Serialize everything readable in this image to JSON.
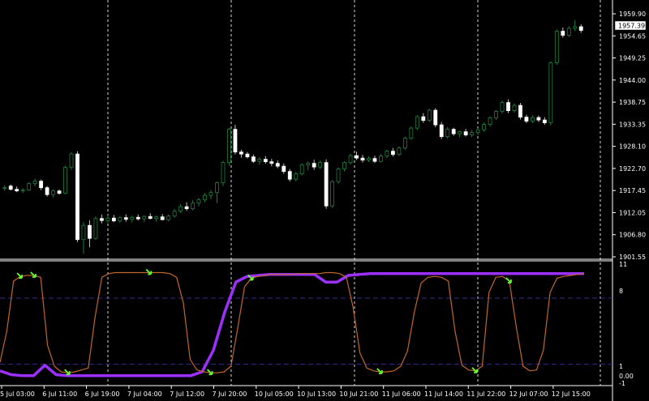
{
  "price_axis_labels": [
    "1959.90",
    "1954.65",
    "1949.25",
    "1944.00",
    "1938.75",
    "1933.35",
    "1928.10",
    "1922.70",
    "1917.45",
    "1912.05",
    "1906.80",
    "1901.55"
  ],
  "current_price": "1957.39",
  "indicator_axis_labels": [
    "11",
    "8",
    "1",
    "0.00",
    "-1"
  ],
  "time_labels": [
    "5 Jul 03:00",
    "6 Jul 11:00",
    "6 Jul 19:00",
    "7 Jul 04:00",
    "7 Jul 12:00",
    "7 Jul 20:00",
    "10 Jul 05:00",
    "10 Jul 13:00",
    "10 Jul 21:00",
    "11 Jul 06:00",
    "11 Jul 14:00",
    "11 Jul 22:00",
    "12 Jul 07:00",
    "12 Jul 15:00"
  ],
  "colors": {
    "background": "#000000",
    "candle_bull": "#000000",
    "candle_bull_border": "#1e7f3c",
    "candle_bear": "#ffffff",
    "grid": "#ffffff",
    "fast_line": "#c0672a",
    "slow_line": "#9b30ff",
    "level_line": "#3a2a8c",
    "arrow": "#66ff33"
  },
  "chart_data": [
    {
      "type": "candlestick",
      "title": "",
      "ylim": [
        1901.55,
        1961.5
      ],
      "candles": [
        [
          1918.6,
          1919.2,
          1917.8,
          1918.6
        ],
        [
          1919.0,
          1919.4,
          1917.9,
          1918.2
        ],
        [
          1918.2,
          1918.9,
          1917.5,
          1917.8
        ],
        [
          1917.8,
          1918.5,
          1917.3,
          1918.0
        ],
        [
          1918.0,
          1920.0,
          1917.8,
          1919.6
        ],
        [
          1919.6,
          1920.8,
          1919.0,
          1920.2
        ],
        [
          1920.2,
          1920.6,
          1918.0,
          1918.6
        ],
        [
          1918.6,
          1919.0,
          1916.4,
          1916.9
        ],
        [
          1916.9,
          1918.2,
          1916.2,
          1917.8
        ],
        [
          1917.8,
          1918.1,
          1916.9,
          1917.2
        ],
        [
          1917.2,
          1924.0,
          1917.0,
          1923.6
        ],
        [
          1923.6,
          1927.4,
          1923.0,
          1926.9
        ],
        [
          1926.9,
          1927.6,
          1905.2,
          1905.8
        ],
        [
          1905.8,
          1910.1,
          1902.3,
          1909.3
        ],
        [
          1909.3,
          1910.6,
          1903.9,
          1906.1
        ],
        [
          1906.1,
          1911.5,
          1905.8,
          1911.0
        ],
        [
          1911.0,
          1912.0,
          1909.8,
          1910.5
        ],
        [
          1910.5,
          1911.8,
          1909.9,
          1911.1
        ],
        [
          1911.1,
          1911.9,
          1910.1,
          1910.4
        ],
        [
          1910.4,
          1911.6,
          1909.9,
          1911.2
        ],
        [
          1911.2,
          1912.0,
          1910.2,
          1910.8
        ],
        [
          1910.8,
          1911.7,
          1910.0,
          1911.3
        ],
        [
          1911.3,
          1912.0,
          1910.5,
          1910.9
        ],
        [
          1910.9,
          1911.8,
          1910.1,
          1911.5
        ],
        [
          1911.5,
          1912.3,
          1910.8,
          1911.0
        ],
        [
          1911.0,
          1911.7,
          1910.2,
          1911.4
        ],
        [
          1911.4,
          1912.1,
          1910.6,
          1910.7
        ],
        [
          1910.7,
          1912.0,
          1910.3,
          1911.6
        ],
        [
          1911.6,
          1913.4,
          1911.2,
          1912.8
        ],
        [
          1912.8,
          1914.6,
          1912.3,
          1913.9
        ],
        [
          1913.9,
          1915.0,
          1912.9,
          1913.4
        ],
        [
          1913.4,
          1915.5,
          1913.0,
          1914.8
        ],
        [
          1914.8,
          1916.1,
          1914.0,
          1915.6
        ],
        [
          1915.6,
          1917.3,
          1915.0,
          1916.7
        ],
        [
          1916.7,
          1918.0,
          1915.8,
          1917.4
        ],
        [
          1917.4,
          1920.1,
          1914.8,
          1919.8
        ],
        [
          1919.8,
          1925.2,
          1919.0,
          1924.8
        ],
        [
          1924.8,
          1933.4,
          1924.0,
          1933.0
        ],
        [
          1933.0,
          1934.1,
          1926.8,
          1927.4
        ],
        [
          1927.4,
          1928.0,
          1926.0,
          1926.9
        ],
        [
          1926.9,
          1927.4,
          1925.8,
          1926.2
        ],
        [
          1926.2,
          1926.8,
          1924.7,
          1925.1
        ],
        [
          1925.1,
          1926.1,
          1924.3,
          1925.6
        ],
        [
          1925.6,
          1926.4,
          1924.5,
          1925.0
        ],
        [
          1925.0,
          1925.7,
          1923.9,
          1924.6
        ],
        [
          1924.6,
          1925.3,
          1923.4,
          1923.9
        ],
        [
          1923.9,
          1924.6,
          1922.0,
          1922.6
        ],
        [
          1922.6,
          1923.2,
          1920.1,
          1920.7
        ],
        [
          1920.7,
          1922.5,
          1920.2,
          1922.0
        ],
        [
          1922.0,
          1924.6,
          1921.6,
          1924.2
        ],
        [
          1924.2,
          1925.1,
          1922.9,
          1924.6
        ],
        [
          1924.6,
          1925.5,
          1923.0,
          1923.7
        ],
        [
          1923.7,
          1925.3,
          1923.2,
          1924.8
        ],
        [
          1924.8,
          1925.6,
          1913.4,
          1914.1
        ],
        [
          1914.1,
          1920.5,
          1913.6,
          1920.1
        ],
        [
          1920.1,
          1923.6,
          1919.6,
          1923.2
        ],
        [
          1923.2,
          1925.1,
          1922.6,
          1924.8
        ],
        [
          1924.8,
          1927.0,
          1924.3,
          1926.5
        ],
        [
          1926.5,
          1927.5,
          1925.4,
          1925.9
        ],
        [
          1925.9,
          1926.7,
          1924.8,
          1925.4
        ],
        [
          1925.4,
          1926.3,
          1924.9,
          1925.8
        ],
        [
          1925.8,
          1926.5,
          1924.7,
          1925.1
        ],
        [
          1925.1,
          1926.9,
          1924.8,
          1926.4
        ],
        [
          1926.4,
          1928.0,
          1925.9,
          1927.6
        ],
        [
          1927.6,
          1928.4,
          1926.3,
          1926.8
        ],
        [
          1926.8,
          1928.8,
          1926.4,
          1928.4
        ],
        [
          1928.4,
          1931.2,
          1927.9,
          1930.8
        ],
        [
          1930.8,
          1933.7,
          1930.4,
          1933.3
        ],
        [
          1933.3,
          1936.5,
          1932.8,
          1936.1
        ],
        [
          1936.1,
          1937.0,
          1934.6,
          1935.2
        ],
        [
          1935.2,
          1938.1,
          1934.8,
          1937.7
        ],
        [
          1937.7,
          1938.2,
          1933.5,
          1934.1
        ],
        [
          1934.1,
          1934.8,
          1930.6,
          1931.2
        ],
        [
          1931.2,
          1933.6,
          1930.7,
          1933.0
        ],
        [
          1933.0,
          1933.4,
          1931.4,
          1931.9
        ],
        [
          1931.9,
          1932.7,
          1931.0,
          1932.4
        ],
        [
          1932.4,
          1933.1,
          1931.2,
          1931.6
        ],
        [
          1931.6,
          1932.8,
          1931.1,
          1932.2
        ],
        [
          1932.2,
          1933.3,
          1931.6,
          1932.9
        ],
        [
          1932.9,
          1934.7,
          1932.4,
          1934.2
        ],
        [
          1934.2,
          1936.2,
          1933.7,
          1935.8
        ],
        [
          1935.8,
          1937.8,
          1935.3,
          1937.4
        ],
        [
          1937.4,
          1940.1,
          1936.9,
          1939.6
        ],
        [
          1939.6,
          1940.4,
          1937.0,
          1937.6
        ],
        [
          1937.6,
          1939.4,
          1937.1,
          1938.9
        ],
        [
          1938.9,
          1939.5,
          1935.4,
          1936.0
        ],
        [
          1936.0,
          1936.6,
          1934.5,
          1935.0
        ],
        [
          1935.0,
          1936.4,
          1934.5,
          1935.9
        ],
        [
          1935.9,
          1936.4,
          1934.8,
          1935.3
        ],
        [
          1935.3,
          1936.0,
          1934.1,
          1934.6
        ],
        [
          1934.6,
          1949.8,
          1934.0,
          1949.4
        ],
        [
          1949.4,
          1957.6,
          1948.9,
          1957.2
        ],
        [
          1957.2,
          1958.1,
          1955.6,
          1956.2
        ],
        [
          1956.2,
          1958.5,
          1955.8,
          1957.9
        ],
        [
          1957.9,
          1959.9,
          1957.2,
          1958.3
        ],
        [
          1958.3,
          1958.9,
          1956.8,
          1957.4
        ]
      ]
    },
    {
      "type": "line",
      "title": "",
      "ylim": [
        -1,
        11
      ],
      "levels": [
        8,
        1
      ],
      "fast_values": [
        1.2,
        4.5,
        9.8,
        10.3,
        10.4,
        10.4,
        10.2,
        3.0,
        0.8,
        0.2,
        0.1,
        0.2,
        0.4,
        0.6,
        6.0,
        10.2,
        10.6,
        10.7,
        10.7,
        10.7,
        10.7,
        10.7,
        10.7,
        10.7,
        10.7,
        10.6,
        10.2,
        7.5,
        1.5,
        0.4,
        0.2,
        0.1,
        0.1,
        0.2,
        0.8,
        4.8,
        9.2,
        10.1,
        10.3,
        10.4,
        10.5,
        10.5,
        10.5,
        10.5,
        10.6,
        10.6,
        10.6,
        10.6,
        10.7,
        10.7,
        10.6,
        10.2,
        7.0,
        2.2,
        0.6,
        0.3,
        0.2,
        0.2,
        0.3,
        0.8,
        2.4,
        6.5,
        9.6,
        10.2,
        10.3,
        10.2,
        9.8,
        4.5,
        0.9,
        0.4,
        0.3,
        0.8,
        8.6,
        10.2,
        10.3,
        9.8,
        5.0,
        0.8,
        0.3,
        0.4,
        2.5,
        8.6,
        10.1,
        10.3,
        10.4,
        10.5,
        10.6
      ],
      "slow_values": [
        0.3,
        -0.1,
        -0.2,
        -0.2,
        0.9,
        -0.1,
        -0.2,
        -0.2,
        -0.2,
        -0.2,
        -0.2,
        -0.2,
        -0.2,
        -0.2,
        -0.2,
        -0.2,
        -0.2,
        -0.2,
        0.2,
        2.5,
        6.5,
        9.7,
        10.3,
        10.4,
        10.5,
        10.5,
        10.5,
        10.5,
        10.5,
        9.7,
        9.7,
        10.4,
        10.5,
        10.6,
        10.6,
        10.6,
        10.6,
        10.6,
        10.6,
        10.6,
        10.6,
        10.6,
        10.6,
        10.6,
        10.6,
        10.6,
        10.6,
        10.6,
        10.6,
        10.6,
        10.6,
        10.6,
        10.6
      ],
      "arrows": [
        {
          "series": "fast",
          "at": 3
        },
        {
          "series": "fast",
          "at": 5
        },
        {
          "series": "fast",
          "at": 10
        },
        {
          "series": "fast",
          "at": 22
        },
        {
          "series": "fast",
          "at": 31
        },
        {
          "series": "fast",
          "at": 37
        },
        {
          "series": "fast",
          "at": 56
        },
        {
          "series": "fast",
          "at": 70
        },
        {
          "series": "fast",
          "at": 75
        }
      ]
    }
  ]
}
